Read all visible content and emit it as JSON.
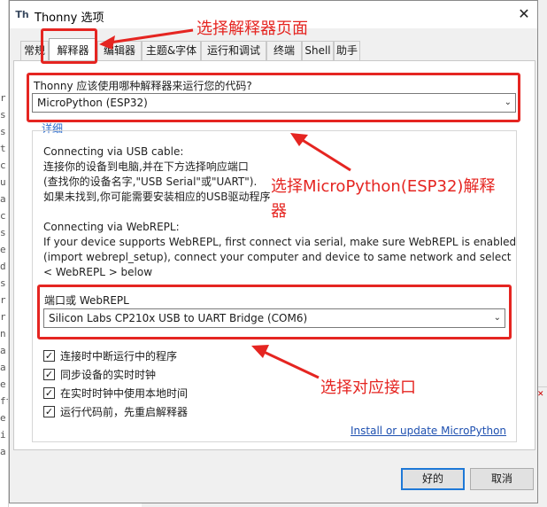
{
  "window": {
    "title": "Thonny 选项",
    "icon": "thonny-app-icon",
    "close_symbol": "✕"
  },
  "tabs": [
    "常规",
    "解释器",
    "编辑器",
    "主题&字体",
    "运行和调试",
    "终端",
    "Shell",
    "助手"
  ],
  "active_tab": "解释器",
  "interpreter": {
    "question": "Thonny 应该使用哪种解释器来运行您的代码?",
    "selected": "MicroPython (ESP32)",
    "details_link": "详细"
  },
  "instructions": {
    "usb_lines": [
      "Connecting via USB cable:",
      "连接你的设备到电脑,并在下方选择响应端口",
      "(查找你的设备名字,\"USB Serial\"或\"UART\").",
      "如果未找到,你可能需要安装相应的USB驱动程序"
    ],
    "webrepl_lines": [
      "Connecting via WebREPL:",
      "If your device supports WebREPL, first connect via serial, make sure WebREPL is enabled",
      "(import webrepl_setup), connect your computer and device to same network and select",
      "< WebREPL > below"
    ]
  },
  "port": {
    "label": "端口或 WebREPL",
    "selected": "Silicon Labs CP210x USB to UART Bridge (COM6)"
  },
  "checkboxes": [
    {
      "label": "连接时中断运行中的程序",
      "checked": true
    },
    {
      "label": "同步设备的实时时钟",
      "checked": true
    },
    {
      "label": "在实时时钟中使用本地时间",
      "checked": true
    },
    {
      "label": "运行代码前，先重启解释器",
      "checked": true
    }
  ],
  "checkmark": "✓",
  "install_link": "Install or update MicroPython",
  "buttons": {
    "ok": "好的",
    "cancel": "取消"
  },
  "annotations": {
    "tab_callout": "选择解释器页面",
    "interpreter_callout_line1": "选择MicroPython(ESP32)解释",
    "interpreter_callout_line2": "器",
    "port_callout": "选择对应接口",
    "color": "#e52521"
  },
  "background_fragments": {
    "left_chars": [
      "r",
      "s",
      "s",
      "t",
      "c",
      "u",
      "a",
      "c",
      "s",
      "e",
      "d",
      "s",
      "r",
      "r",
      "n",
      "a",
      "a",
      "e",
      "ft",
      "e",
      "i",
      "a"
    ]
  }
}
